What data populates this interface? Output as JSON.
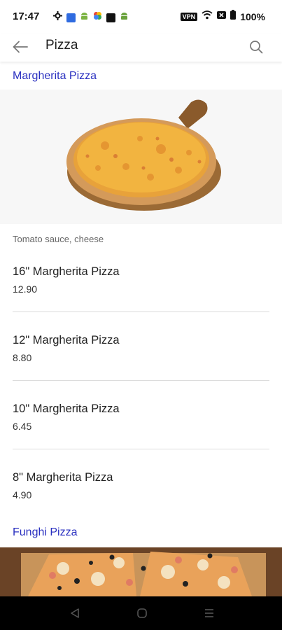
{
  "status_bar": {
    "time": "17:47",
    "vpn": "VPN",
    "battery": "100%"
  },
  "app_bar": {
    "title": "Pizza"
  },
  "sections": [
    {
      "title": "Margherita Pizza",
      "description": "Tomato sauce, cheese",
      "items": [
        {
          "name": "16\" Margherita Pizza",
          "price": "12.90"
        },
        {
          "name": "12\" Margherita Pizza",
          "price": "8.80"
        },
        {
          "name": "10\" Margherita Pizza",
          "price": "6.45"
        },
        {
          "name": "8\" Margherita Pizza",
          "price": "4.90"
        }
      ]
    },
    {
      "title": "Funghi Pizza"
    }
  ],
  "colors": {
    "section_title": "#2a30c0",
    "nav_bar": "#000000"
  },
  "icons": [
    "settings-icon",
    "app-icon",
    "android-icon",
    "photos-icon",
    "square-icon",
    "android-icon",
    "vpn-icon",
    "wifi-icon",
    "x-icon",
    "battery-icon",
    "back-arrow-icon",
    "search-icon",
    "nav-back-icon",
    "nav-home-icon",
    "nav-recents-icon"
  ]
}
